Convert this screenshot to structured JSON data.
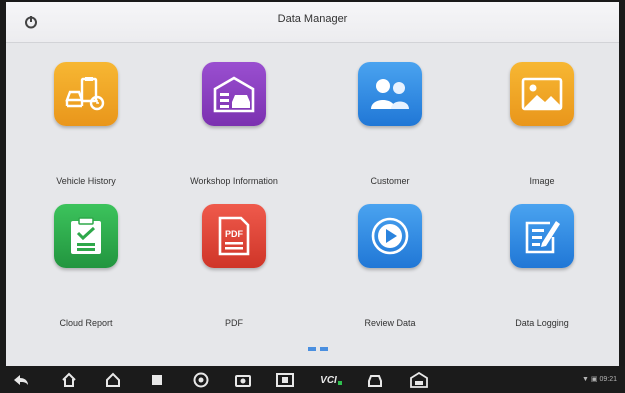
{
  "header": {
    "title": "Data Manager",
    "home_icon": "power-icon"
  },
  "apps": [
    {
      "label": "Vehicle History",
      "icon": "vehicle-history-icon",
      "color": "#f1a41c"
    },
    {
      "label": "Workshop Information",
      "icon": "workshop-icon",
      "color": "#8a3fbf"
    },
    {
      "label": "Customer",
      "icon": "customer-icon",
      "color": "#2e86e0"
    },
    {
      "label": "Image",
      "icon": "image-icon",
      "color": "#f1a41c"
    },
    {
      "label": "Cloud Report",
      "icon": "cloud-report-icon",
      "color": "#2fae4f"
    },
    {
      "label": "PDF",
      "icon": "pdf-icon",
      "color": "#e0473b"
    },
    {
      "label": "Review Data",
      "icon": "play-icon",
      "color": "#2e86e0"
    },
    {
      "label": "Data Logging",
      "icon": "data-logging-icon",
      "color": "#2e86e0"
    }
  ],
  "navbar": {
    "buttons": [
      "back-icon",
      "home-icon",
      "house-icon",
      "recent-apps-icon",
      "chrome-icon",
      "camera-icon",
      "screenshot-icon",
      "vci-icon",
      "car-icon",
      "garage-icon"
    ],
    "vci_label": "VCI"
  },
  "status": {
    "text": "▼ ▣ 09:21"
  }
}
